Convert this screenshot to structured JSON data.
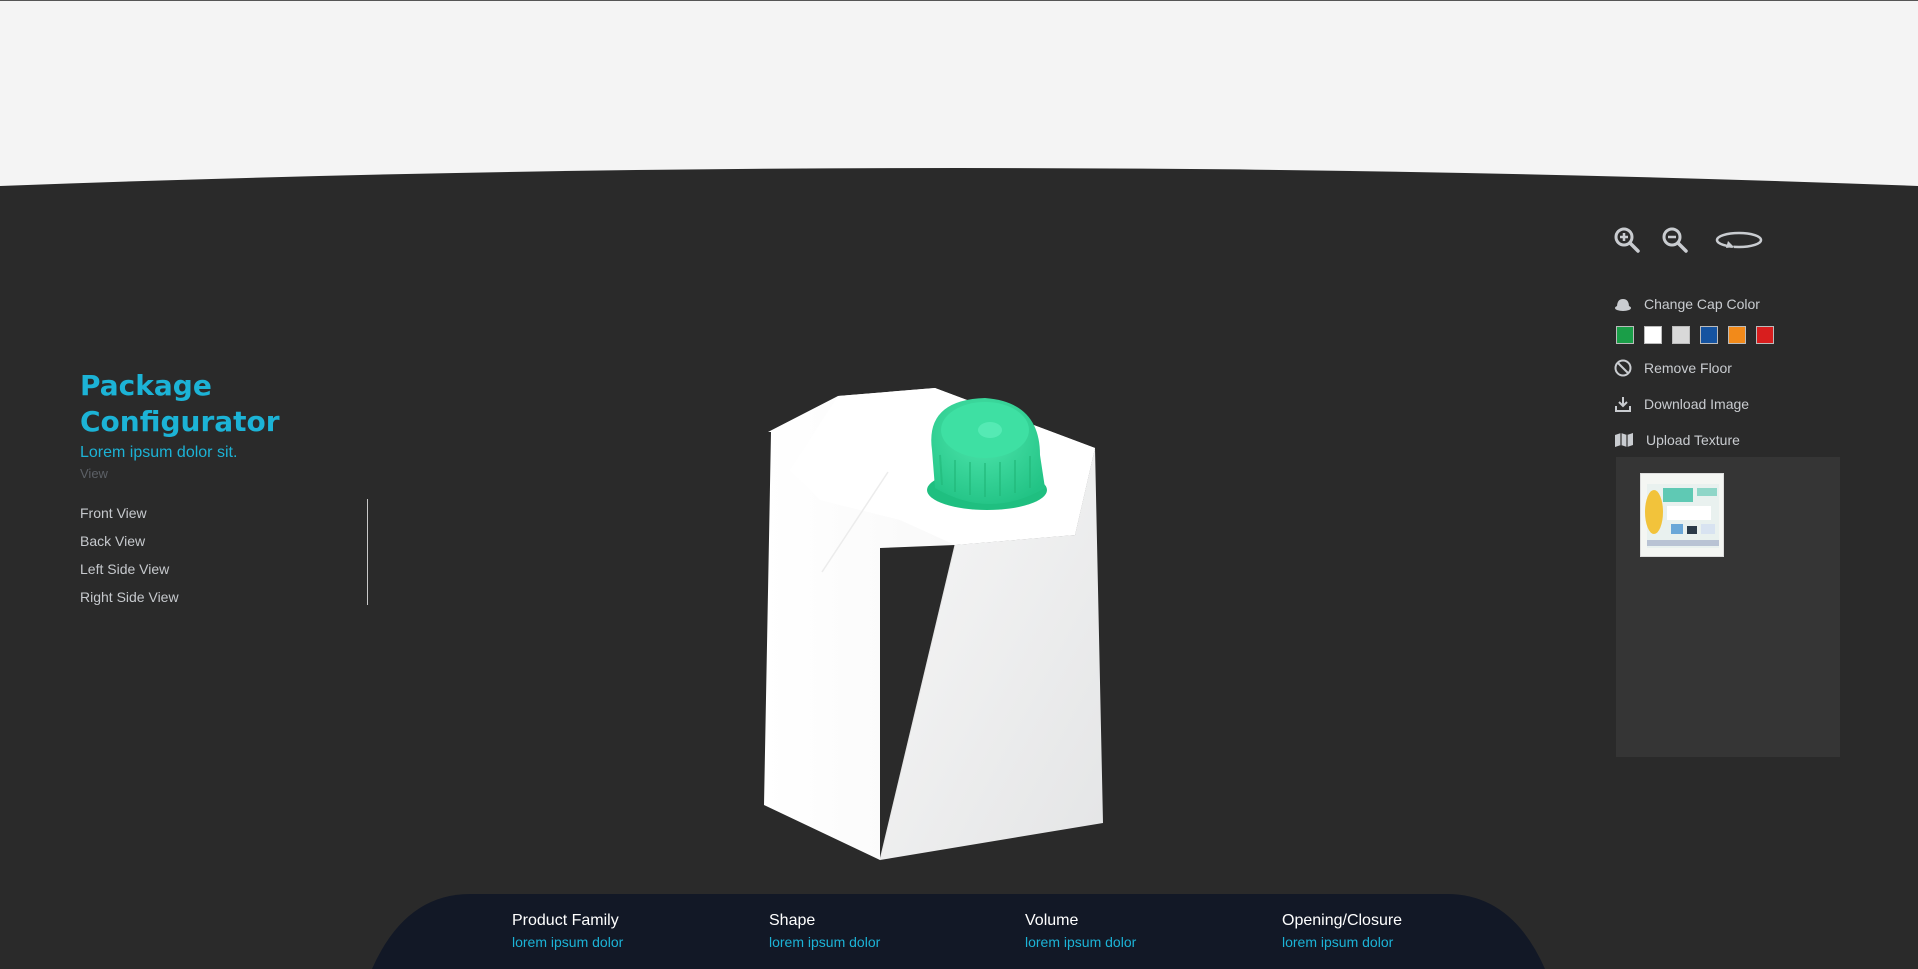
{
  "app": {
    "title": "Package Configurator",
    "subtitle": "Lorem ipsum dolor sit."
  },
  "views": {
    "label": "View",
    "items": [
      "Front View",
      "Back View",
      "Left Side View",
      "Right Side View"
    ]
  },
  "toolbar": {
    "zoom_in_icon": "zoom-in-icon",
    "zoom_out_icon": "zoom-out-icon",
    "rotate_icon": "rotate-icon",
    "change_cap_color": "Change Cap Color",
    "cap_colors": [
      "#1a9e48",
      "#ffffff",
      "#d9d9d9",
      "#1553a0",
      "#f28a1a",
      "#d81e1e"
    ],
    "remove_floor": "Remove Floor",
    "download_image": "Download Image",
    "upload_texture": "Upload Texture"
  },
  "product": {
    "cap_color": "#2fd596",
    "body_color": "#ffffff"
  },
  "info": [
    {
      "label": "Product Family",
      "value": "lorem ipsum dolor"
    },
    {
      "label": "Shape",
      "value": "lorem ipsum dolor"
    },
    {
      "label": "Volume",
      "value": "lorem ipsum dolor"
    },
    {
      "label": "Opening/Closure",
      "value": "lorem ipsum dolor"
    }
  ],
  "colors": {
    "accent": "#1cb3d6",
    "stage_bg": "#2a2a2a",
    "bottom_bar": "#121826",
    "top_bg": "#f4f4f4"
  }
}
